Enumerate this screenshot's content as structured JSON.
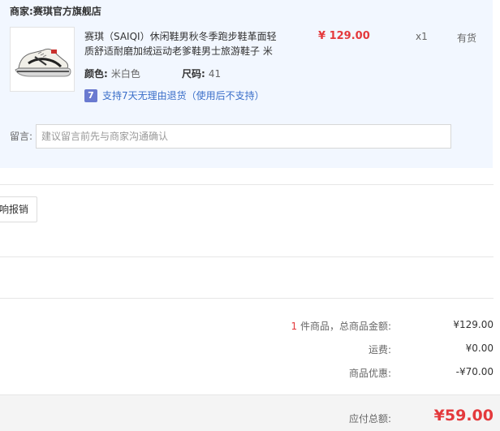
{
  "shop": {
    "label": "商家:",
    "name": "赛琪官方旗舰店"
  },
  "item": {
    "title": "赛琪（SAIQI）休闲鞋男秋冬季跑步鞋革面轻质舒适耐磨加绒运动老爹鞋男士旅游鞋子 米",
    "price": "¥ 129.00",
    "qty": "x1",
    "stock": "有货",
    "color_label": "颜色:",
    "color_value": "米白色",
    "size_label": "尺码:",
    "size_value": "41",
    "return_icon_text": "7",
    "return_text": "支持7天无理由退货（使用后不支持）"
  },
  "memo": {
    "label": "留言:",
    "placeholder": "建议留言前先与商家沟通确认"
  },
  "reimburse": {
    "label": "响报销"
  },
  "summary": {
    "count": "1",
    "items_label": "件商品，总商品金额:",
    "items_total": "¥129.00",
    "shipping_label": "运费:",
    "shipping": "¥0.00",
    "discount_label": "商品优惠:",
    "discount": "-¥70.00",
    "payable_label": "应付总额:",
    "payable": "¥59.00"
  }
}
